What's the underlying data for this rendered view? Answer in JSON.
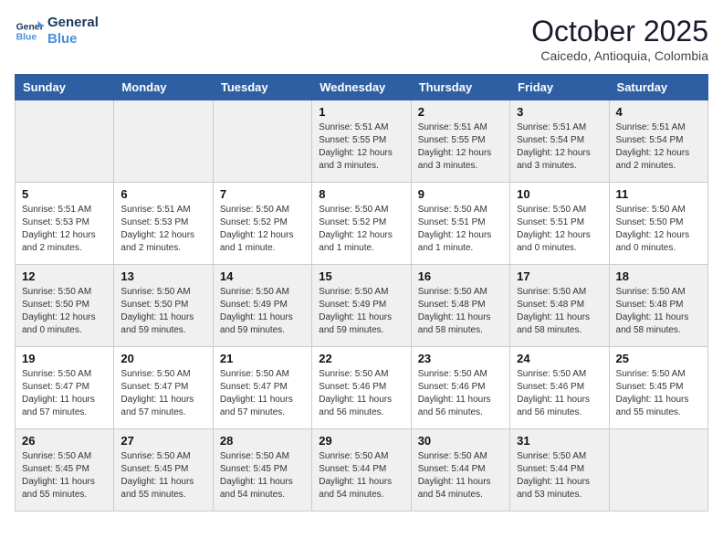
{
  "header": {
    "logo_line1": "General",
    "logo_line2": "Blue",
    "month": "October 2025",
    "location": "Caicedo, Antioquia, Colombia"
  },
  "days_of_week": [
    "Sunday",
    "Monday",
    "Tuesday",
    "Wednesday",
    "Thursday",
    "Friday",
    "Saturday"
  ],
  "weeks": [
    [
      {
        "num": "",
        "info": ""
      },
      {
        "num": "",
        "info": ""
      },
      {
        "num": "",
        "info": ""
      },
      {
        "num": "1",
        "info": "Sunrise: 5:51 AM\nSunset: 5:55 PM\nDaylight: 12 hours\nand 3 minutes."
      },
      {
        "num": "2",
        "info": "Sunrise: 5:51 AM\nSunset: 5:55 PM\nDaylight: 12 hours\nand 3 minutes."
      },
      {
        "num": "3",
        "info": "Sunrise: 5:51 AM\nSunset: 5:54 PM\nDaylight: 12 hours\nand 3 minutes."
      },
      {
        "num": "4",
        "info": "Sunrise: 5:51 AM\nSunset: 5:54 PM\nDaylight: 12 hours\nand 2 minutes."
      }
    ],
    [
      {
        "num": "5",
        "info": "Sunrise: 5:51 AM\nSunset: 5:53 PM\nDaylight: 12 hours\nand 2 minutes."
      },
      {
        "num": "6",
        "info": "Sunrise: 5:51 AM\nSunset: 5:53 PM\nDaylight: 12 hours\nand 2 minutes."
      },
      {
        "num": "7",
        "info": "Sunrise: 5:50 AM\nSunset: 5:52 PM\nDaylight: 12 hours\nand 1 minute."
      },
      {
        "num": "8",
        "info": "Sunrise: 5:50 AM\nSunset: 5:52 PM\nDaylight: 12 hours\nand 1 minute."
      },
      {
        "num": "9",
        "info": "Sunrise: 5:50 AM\nSunset: 5:51 PM\nDaylight: 12 hours\nand 1 minute."
      },
      {
        "num": "10",
        "info": "Sunrise: 5:50 AM\nSunset: 5:51 PM\nDaylight: 12 hours\nand 0 minutes."
      },
      {
        "num": "11",
        "info": "Sunrise: 5:50 AM\nSunset: 5:50 PM\nDaylight: 12 hours\nand 0 minutes."
      }
    ],
    [
      {
        "num": "12",
        "info": "Sunrise: 5:50 AM\nSunset: 5:50 PM\nDaylight: 12 hours\nand 0 minutes."
      },
      {
        "num": "13",
        "info": "Sunrise: 5:50 AM\nSunset: 5:50 PM\nDaylight: 11 hours\nand 59 minutes."
      },
      {
        "num": "14",
        "info": "Sunrise: 5:50 AM\nSunset: 5:49 PM\nDaylight: 11 hours\nand 59 minutes."
      },
      {
        "num": "15",
        "info": "Sunrise: 5:50 AM\nSunset: 5:49 PM\nDaylight: 11 hours\nand 59 minutes."
      },
      {
        "num": "16",
        "info": "Sunrise: 5:50 AM\nSunset: 5:48 PM\nDaylight: 11 hours\nand 58 minutes."
      },
      {
        "num": "17",
        "info": "Sunrise: 5:50 AM\nSunset: 5:48 PM\nDaylight: 11 hours\nand 58 minutes."
      },
      {
        "num": "18",
        "info": "Sunrise: 5:50 AM\nSunset: 5:48 PM\nDaylight: 11 hours\nand 58 minutes."
      }
    ],
    [
      {
        "num": "19",
        "info": "Sunrise: 5:50 AM\nSunset: 5:47 PM\nDaylight: 11 hours\nand 57 minutes."
      },
      {
        "num": "20",
        "info": "Sunrise: 5:50 AM\nSunset: 5:47 PM\nDaylight: 11 hours\nand 57 minutes."
      },
      {
        "num": "21",
        "info": "Sunrise: 5:50 AM\nSunset: 5:47 PM\nDaylight: 11 hours\nand 57 minutes."
      },
      {
        "num": "22",
        "info": "Sunrise: 5:50 AM\nSunset: 5:46 PM\nDaylight: 11 hours\nand 56 minutes."
      },
      {
        "num": "23",
        "info": "Sunrise: 5:50 AM\nSunset: 5:46 PM\nDaylight: 11 hours\nand 56 minutes."
      },
      {
        "num": "24",
        "info": "Sunrise: 5:50 AM\nSunset: 5:46 PM\nDaylight: 11 hours\nand 56 minutes."
      },
      {
        "num": "25",
        "info": "Sunrise: 5:50 AM\nSunset: 5:45 PM\nDaylight: 11 hours\nand 55 minutes."
      }
    ],
    [
      {
        "num": "26",
        "info": "Sunrise: 5:50 AM\nSunset: 5:45 PM\nDaylight: 11 hours\nand 55 minutes."
      },
      {
        "num": "27",
        "info": "Sunrise: 5:50 AM\nSunset: 5:45 PM\nDaylight: 11 hours\nand 55 minutes."
      },
      {
        "num": "28",
        "info": "Sunrise: 5:50 AM\nSunset: 5:45 PM\nDaylight: 11 hours\nand 54 minutes."
      },
      {
        "num": "29",
        "info": "Sunrise: 5:50 AM\nSunset: 5:44 PM\nDaylight: 11 hours\nand 54 minutes."
      },
      {
        "num": "30",
        "info": "Sunrise: 5:50 AM\nSunset: 5:44 PM\nDaylight: 11 hours\nand 54 minutes."
      },
      {
        "num": "31",
        "info": "Sunrise: 5:50 AM\nSunset: 5:44 PM\nDaylight: 11 hours\nand 53 minutes."
      },
      {
        "num": "",
        "info": ""
      }
    ]
  ]
}
